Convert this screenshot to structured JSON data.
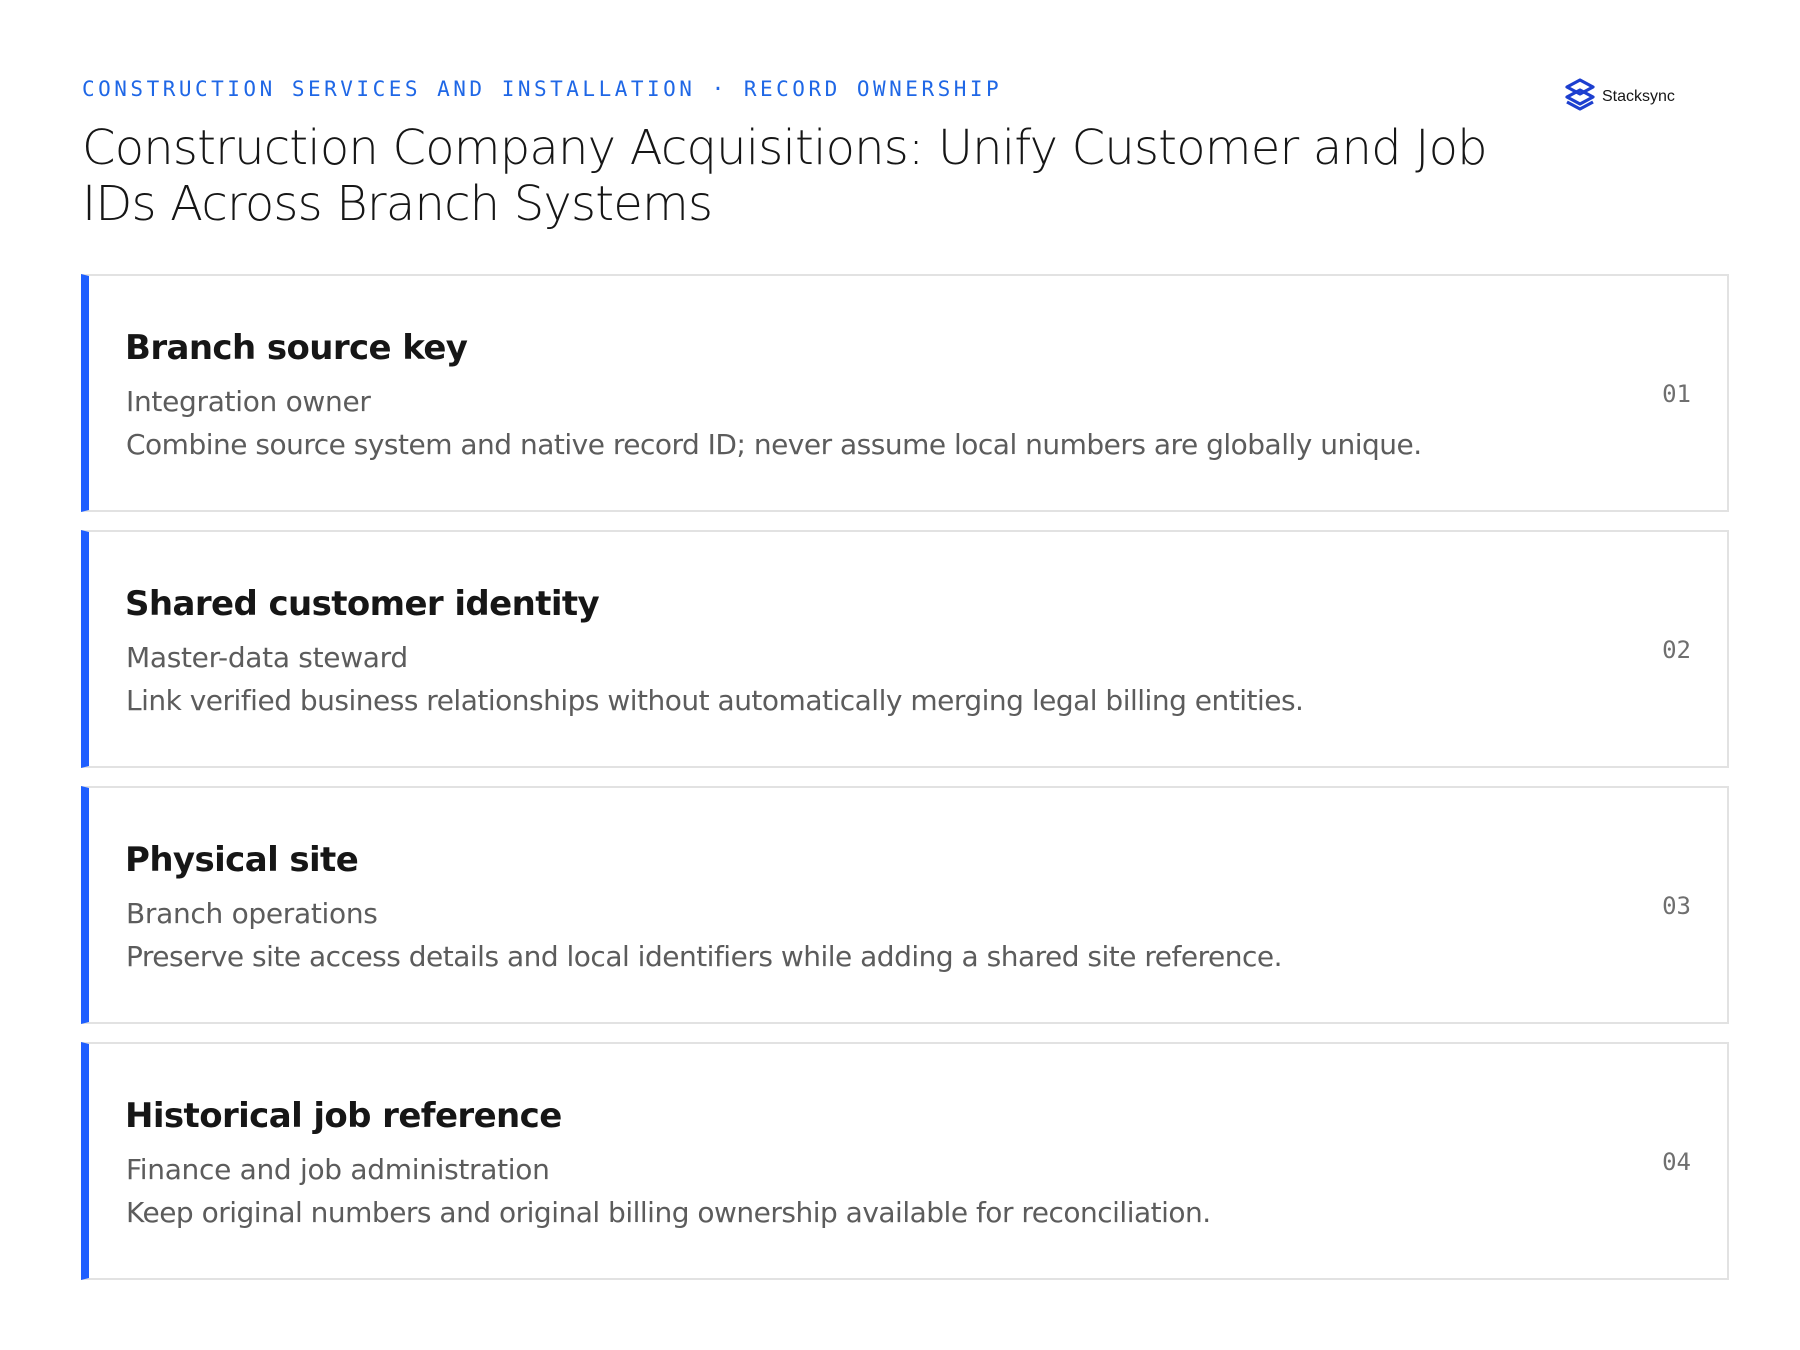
{
  "header": {
    "eyebrow": "CONSTRUCTION SERVICES AND INSTALLATION · RECORD OWNERSHIP",
    "title": "Construction Company Acquisitions: Unify Customer and Job IDs Across Branch Systems"
  },
  "brand": {
    "name": "Stacksync",
    "icon": "stacksync-logo-icon",
    "color": "#1d3fcf"
  },
  "colors": {
    "accent": "#1f5fff",
    "eyebrow": "#1f67e6"
  },
  "cards": [
    {
      "title": "Branch source key",
      "owner": "Integration owner",
      "description": "Combine source system and native record ID; never assume local numbers are globally unique.",
      "number": "01"
    },
    {
      "title": "Shared customer identity",
      "owner": "Master-data steward",
      "description": "Link verified business relationships without automatically merging legal billing entities.",
      "number": "02"
    },
    {
      "title": "Physical site",
      "owner": "Branch operations",
      "description": "Preserve site access details and local identifiers while adding a shared site reference.",
      "number": "03"
    },
    {
      "title": "Historical job reference",
      "owner": "Finance and job administration",
      "description": "Keep original numbers and original billing ownership available for reconciliation.",
      "number": "04"
    }
  ]
}
